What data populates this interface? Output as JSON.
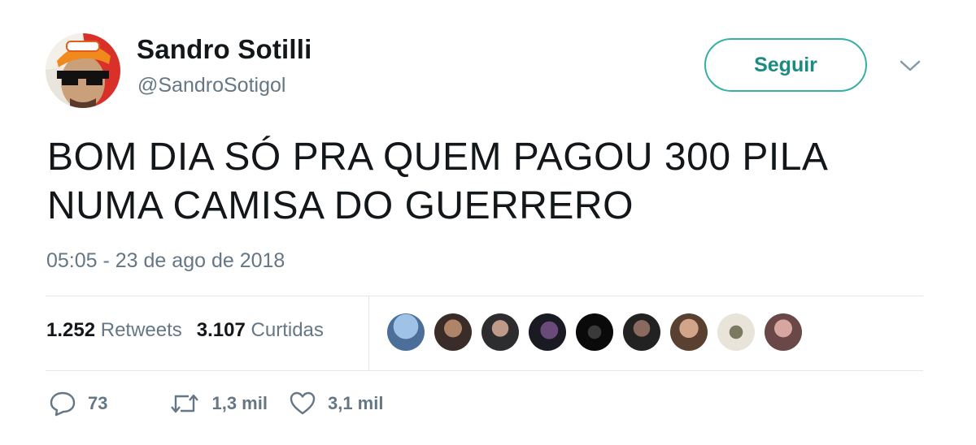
{
  "user": {
    "name": "Sandro Sotilli",
    "handle": "@SandroSotigol"
  },
  "follow_button": {
    "label": "Seguir"
  },
  "tweet": {
    "text": "BOM DIA SÓ PRA QUEM PAGOU 300 PILA\nNUMA CAMISA DO GUERRERO",
    "timestamp": "05:05 - 23 de ago de 2018"
  },
  "stats": {
    "retweets_count": "1.252",
    "retweets_label": "Retweets",
    "likes_count": "3.107",
    "likes_label": "Curtidas"
  },
  "actions": {
    "replies": "73",
    "retweets": "1,3 mil",
    "likes": "3,1 mil"
  },
  "colors": {
    "accent": "#36b0a6",
    "secondary_text": "#657786",
    "divider": "#e1e8ed"
  }
}
